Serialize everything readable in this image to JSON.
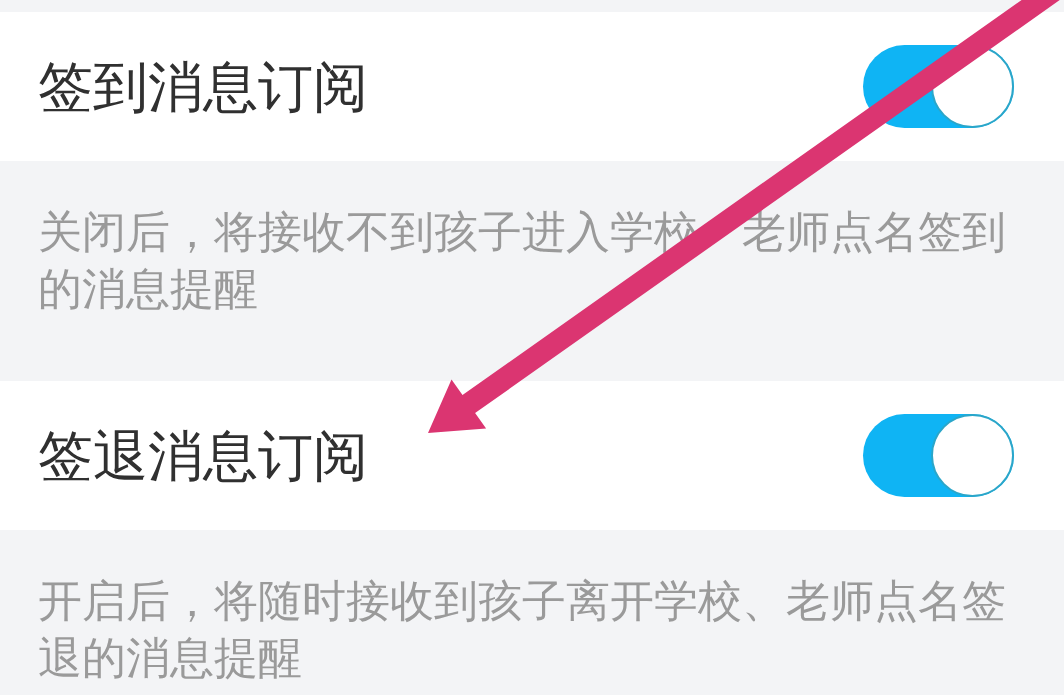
{
  "settings": [
    {
      "title": "签到消息订阅",
      "on": true,
      "description": "关闭后，将接收不到孩子进入学校　老师点名签到的消息提醒"
    },
    {
      "title": "签退消息订阅",
      "on": true,
      "description": "开启后，将随时接收到孩子离开学校、老师点名签退的消息提醒"
    }
  ]
}
